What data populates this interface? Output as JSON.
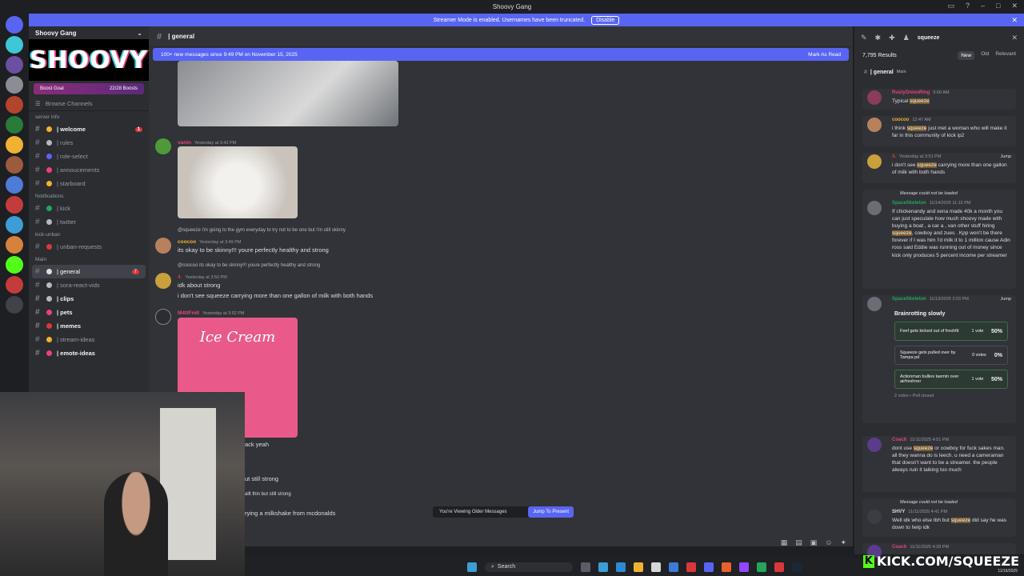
{
  "window": {
    "title": "Shoovy Gang"
  },
  "banner": {
    "text": "Streamer Mode is enabled. Usernames have been truncated.",
    "button": "Disable"
  },
  "server": {
    "name": "Shoovy Gang",
    "banner_text": "SHOOVY",
    "boost_goal": "Boost Goal",
    "boosts": "22/28 Boosts",
    "browse": "Browse Channels",
    "categories": {
      "server_info": "server info",
      "notifications": "Notifications",
      "kick_unban": "kick-unban",
      "main": "Main"
    },
    "channels": [
      {
        "label": "| welcome",
        "bold": true,
        "badge": "1",
        "color": "#f0b232"
      },
      {
        "label": "| rules",
        "color": "#b5bac1"
      },
      {
        "label": "| role-select",
        "color": "#5865f2"
      },
      {
        "label": "| annoucements",
        "color": "#e8427c"
      },
      {
        "label": "| starboard",
        "color": "#f0b232"
      },
      {
        "label": "| kick",
        "color": "#23a55a"
      },
      {
        "label": "| twitter",
        "color": "#b5bac1"
      },
      {
        "label": "| unban-requests",
        "color": "#da373c"
      },
      {
        "label": "| general",
        "active": true,
        "badge": "7",
        "color": "#dbdee1"
      },
      {
        "label": "| sora-react-vids",
        "color": "#b5bac1"
      },
      {
        "label": "| clips",
        "bold": true,
        "color": "#b5bac1"
      },
      {
        "label": "| pets",
        "bold": true,
        "color": "#e8427c"
      },
      {
        "label": "| memes",
        "bold": true,
        "color": "#da373c"
      },
      {
        "label": "| stream-ideas",
        "color": "#f0b232"
      },
      {
        "label": "| emote-ideas",
        "bold": true,
        "color": "#e8427c"
      }
    ]
  },
  "chat": {
    "channel": "| general",
    "new_messages": "100+ new messages since 9:49 PM on November 15, 2025",
    "mark_read": "Mark As Read",
    "messages": {
      "m1": {
        "user": "vanin",
        "time": "Yesterday at 3:42 PM"
      },
      "m2_reply": "@squeeze i'm going to the gym everyday to try not to be one but i'm still skinny",
      "m2": {
        "user": "coocoo",
        "time": "Yesterday at 3:49 PM",
        "text": "its okay to be skinny!!! youre perfectly healthy and strong"
      },
      "m3_reply": "@coocoo its okay to be skinny!!! youre perfectly healthy and strong",
      "m3": {
        "user": "4.",
        "time": "Yesterday at 3:50 PM",
        "text1": "idk about strong",
        "text2": "i don't see squeeze carrying more than one gallon of milk with both hands"
      },
      "m4": {
        "user": "M4ttFmlt",
        "time": "Yesterday at 3:52 PM",
        "image_text": "Ice Cream"
      },
      "m5_text": "ack yeah",
      "m6_text": "ut still strong",
      "m7_text": "allt thin but still strong",
      "m8_text": "rying a milkshake from mcdonalds"
    },
    "older_notice": "You're Viewing Older Messages",
    "jump_present": "Jump To Present"
  },
  "search": {
    "query": "squeeze",
    "count": "7,795 Results",
    "tabs": [
      "New",
      "Old",
      "Relevant"
    ],
    "channel": "| general",
    "channel_tag": "Main",
    "results": [
      {
        "user": "RustyOnionRing",
        "time": "5:00 AM",
        "text": "Typical squeeze",
        "name_color": "#e8427c"
      },
      {
        "user": "coocoo",
        "time": "12:47 AM",
        "text": "i think squeeze just met a woman who will make it far in this community of kick ip2",
        "name_color": "#f0b232"
      },
      {
        "user": "4.",
        "time": "Yesterday at 3:51 PM",
        "text": "i don't see squeeze carrying more than one gallon of milk with both hands",
        "name_color": "#da373c",
        "jump": "Jump"
      },
      {
        "not_loaded": "Message could not be loaded",
        "user": "SpaceSkeleton",
        "time": "11/14/2025 11:15 PM",
        "text": "If chickenandy and xena  made 40k a month you can just speculate how much shoovy made with buying a boat , a car a , van other stuff hiring squeeze, cowboy and zues . Kpp won't be there forever if I was him I'd milk it to 1 million cause Adin ross said Eddie was running out of money since kick only produces 5 percent income per streamer",
        "name_color": "#23a55a"
      },
      {
        "user": "SpaceSkeleton",
        "time": "11/13/2025 2:03 PM",
        "name_color": "#23a55a",
        "jump": "Jump",
        "poll": {
          "question": "Brainrotting slowly",
          "options": [
            {
              "text": "Feef gets kicked out of freshfit",
              "votes": "1 vote",
              "pct": "50%",
              "fill": 0.5
            },
            {
              "text": "Squeeze gets pulled over by Tampa pd",
              "votes": "0 votes",
              "pct": "0%",
              "fill": 0
            },
            {
              "text": "Actionman bullies taemin over airfreshner",
              "votes": "1 vote",
              "pct": "50%",
              "fill": 0.5
            }
          ],
          "footer": "2 votes  •  Poll closed"
        }
      },
      {
        "user": "Coach",
        "time": "11/11/2025 4:51 PM",
        "text": "dont use squeeze or cowboy for fuck sakes man. all they wanna do is leech. u need a cameraman that doesn't want to be a streamer. the people always ruin it talking too much",
        "name_color": "#e8427c"
      },
      {
        "not_loaded": "Message could not be loaded",
        "user": "SHVY",
        "time": "11/11/2025 4:41 PM",
        "text": "Well idk who else tbh but squeeze did say he was down to help idk",
        "name_color": "#dbdee1"
      },
      {
        "user": "Coach",
        "time": "11/11/2025 4:39 PM",
        "name_color": "#e8427c"
      }
    ]
  },
  "taskbar": {
    "search": "Search"
  },
  "overlay": {
    "kick": "KICK.COM/SQUEEZE",
    "date": "11/16/2025"
  }
}
